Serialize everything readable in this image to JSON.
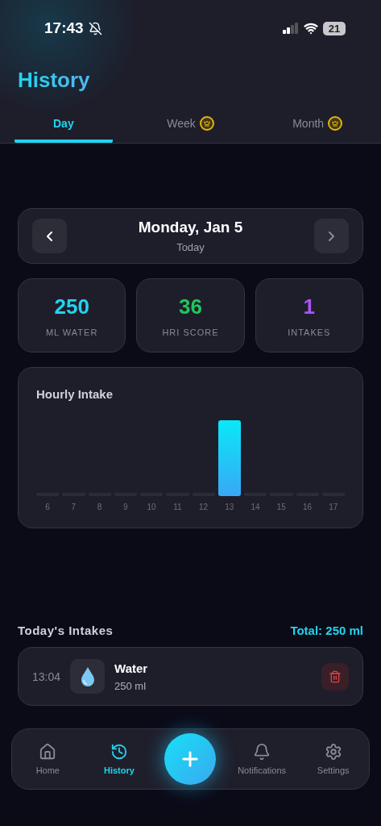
{
  "status_bar": {
    "time": "17:43",
    "battery": "21"
  },
  "title": "History",
  "tabs": [
    {
      "label": "Day",
      "selected": true,
      "premium": false
    },
    {
      "label": "Week",
      "selected": false,
      "premium": true
    },
    {
      "label": "Month",
      "selected": false,
      "premium": true
    }
  ],
  "date_nav": {
    "date": "Monday, Jan 5",
    "subtitle": "Today"
  },
  "stats": [
    {
      "value": "250",
      "label": "ML WATER",
      "color": "#22d3ee"
    },
    {
      "value": "36",
      "label": "HRI SCORE",
      "color": "#22c55e"
    },
    {
      "value": "1",
      "label": "INTAKES",
      "color": "#a855f7"
    }
  ],
  "chart": {
    "title": "Hourly Intake",
    "hours": [
      {
        "label": "6",
        "level": 0
      },
      {
        "label": "7",
        "level": 0
      },
      {
        "label": "8",
        "level": 0
      },
      {
        "label": "9",
        "level": 0
      },
      {
        "label": "10",
        "level": 0
      },
      {
        "label": "11",
        "level": 0
      },
      {
        "label": "12",
        "level": 0
      },
      {
        "label": "13",
        "level": 1
      },
      {
        "label": "14",
        "level": 0
      },
      {
        "label": "15",
        "level": 0
      },
      {
        "label": "16",
        "level": 0
      },
      {
        "label": "17",
        "level": 0
      }
    ]
  },
  "intakes": {
    "title": "Today's Intakes",
    "total": "Total: 250 ml",
    "items": [
      {
        "time": "13:04",
        "name": "Water",
        "amount": "250 ml"
      }
    ]
  },
  "nav": [
    {
      "label": "Home",
      "kind": "home",
      "selected": false
    },
    {
      "label": "History",
      "kind": "history",
      "selected": true
    },
    {
      "kind": "add"
    },
    {
      "label": "Notifications",
      "kind": "bell",
      "selected": false
    },
    {
      "label": "Settings",
      "kind": "gear",
      "selected": false
    }
  ]
}
